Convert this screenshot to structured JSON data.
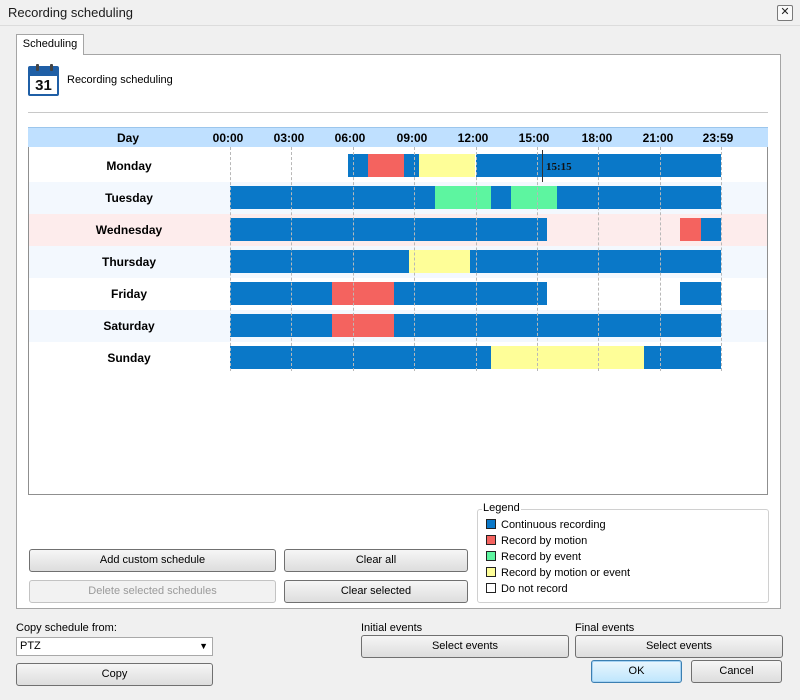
{
  "window": {
    "title": "Recording scheduling",
    "close_glyph": "✕"
  },
  "tab": {
    "label": "Scheduling"
  },
  "header": {
    "calendar_day": "31",
    "title": "Recording scheduling"
  },
  "grid": {
    "day_column_label": "Day",
    "time_labels": [
      "00:00",
      "03:00",
      "06:00",
      "09:00",
      "12:00",
      "15:00",
      "18:00",
      "21:00",
      "23:59"
    ],
    "current_time": "15:15",
    "rows": [
      {
        "day": "Monday",
        "highlight": false,
        "segments": [
          {
            "start": "05:45",
            "end": "06:45",
            "mode": "continuous"
          },
          {
            "start": "06:45",
            "end": "08:30",
            "mode": "motion"
          },
          {
            "start": "08:30",
            "end": "09:15",
            "mode": "continuous"
          },
          {
            "start": "09:15",
            "end": "12:00",
            "mode": "motion_or_event"
          },
          {
            "start": "12:00",
            "end": "23:59",
            "mode": "continuous"
          }
        ]
      },
      {
        "day": "Tuesday",
        "highlight": false,
        "segments": [
          {
            "start": "00:00",
            "end": "10:00",
            "mode": "continuous"
          },
          {
            "start": "10:00",
            "end": "12:45",
            "mode": "event"
          },
          {
            "start": "12:45",
            "end": "13:45",
            "mode": "continuous"
          },
          {
            "start": "13:45",
            "end": "16:00",
            "mode": "event"
          },
          {
            "start": "16:00",
            "end": "23:59",
            "mode": "continuous"
          }
        ]
      },
      {
        "day": "Wednesday",
        "highlight": true,
        "segments": [
          {
            "start": "00:00",
            "end": "15:30",
            "mode": "continuous"
          },
          {
            "start": "22:00",
            "end": "23:00",
            "mode": "motion"
          },
          {
            "start": "23:00",
            "end": "23:59",
            "mode": "continuous"
          }
        ]
      },
      {
        "day": "Thursday",
        "highlight": false,
        "segments": [
          {
            "start": "00:00",
            "end": "08:45",
            "mode": "continuous"
          },
          {
            "start": "08:45",
            "end": "11:45",
            "mode": "motion_or_event"
          },
          {
            "start": "11:45",
            "end": "23:59",
            "mode": "continuous"
          }
        ]
      },
      {
        "day": "Friday",
        "highlight": false,
        "segments": [
          {
            "start": "00:00",
            "end": "05:00",
            "mode": "continuous"
          },
          {
            "start": "05:00",
            "end": "08:00",
            "mode": "motion"
          },
          {
            "start": "08:00",
            "end": "15:30",
            "mode": "continuous"
          },
          {
            "start": "22:00",
            "end": "23:59",
            "mode": "continuous"
          }
        ]
      },
      {
        "day": "Saturday",
        "highlight": false,
        "segments": [
          {
            "start": "00:00",
            "end": "05:00",
            "mode": "continuous"
          },
          {
            "start": "05:00",
            "end": "08:00",
            "mode": "motion"
          },
          {
            "start": "08:00",
            "end": "23:59",
            "mode": "continuous"
          }
        ]
      },
      {
        "day": "Sunday",
        "highlight": false,
        "segments": [
          {
            "start": "00:00",
            "end": "12:45",
            "mode": "continuous"
          },
          {
            "start": "12:45",
            "end": "20:15",
            "mode": "motion_or_event"
          },
          {
            "start": "20:15",
            "end": "23:59",
            "mode": "continuous"
          }
        ]
      }
    ]
  },
  "legend": {
    "title": "Legend",
    "items": [
      {
        "key": "continuous",
        "label": "Continuous recording",
        "color": "#0a78c8"
      },
      {
        "key": "motion",
        "label": "Record by motion",
        "color": "#f4635f"
      },
      {
        "key": "event",
        "label": "Record by event",
        "color": "#5df5a0"
      },
      {
        "key": "motion_or_event",
        "label": "Record by motion or event",
        "color": "#fefe98"
      },
      {
        "key": "none",
        "label": "Do not record",
        "color": "#ffffff"
      }
    ]
  },
  "colors": {
    "row_alt": "#f3f8fe",
    "row_highlight": "#fdecec",
    "row_plain": "#ffffff",
    "header_bg": "#bfe0ff"
  },
  "buttons": {
    "add_custom_schedule": "Add custom schedule",
    "clear_all": "Clear all",
    "delete_selected_schedules": "Delete selected schedules",
    "clear_selected": "Clear selected",
    "copy": "Copy",
    "select_events_initial": "Select events",
    "select_events_final": "Select events",
    "ok": "OK",
    "cancel": "Cancel"
  },
  "bottom": {
    "copy_schedule_from_label": "Copy schedule from:",
    "copy_schedule_from_value": "PTZ",
    "initial_events_label": "Initial events",
    "final_events_label": "Final events"
  }
}
